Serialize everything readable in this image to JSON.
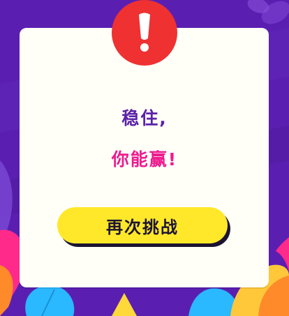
{
  "dialog": {
    "icon": "exclamation-icon",
    "line1": "稳住,",
    "line2": "你能赢!",
    "retry_label": "再次挑战"
  },
  "colors": {
    "background": "#5a1fb0",
    "card": "#fffff8",
    "alert": "#ef3131",
    "line1_text": "#5b22a8",
    "line2_text": "#ee1b8f",
    "button": "#ffe82a",
    "button_text": "#1c1430"
  }
}
